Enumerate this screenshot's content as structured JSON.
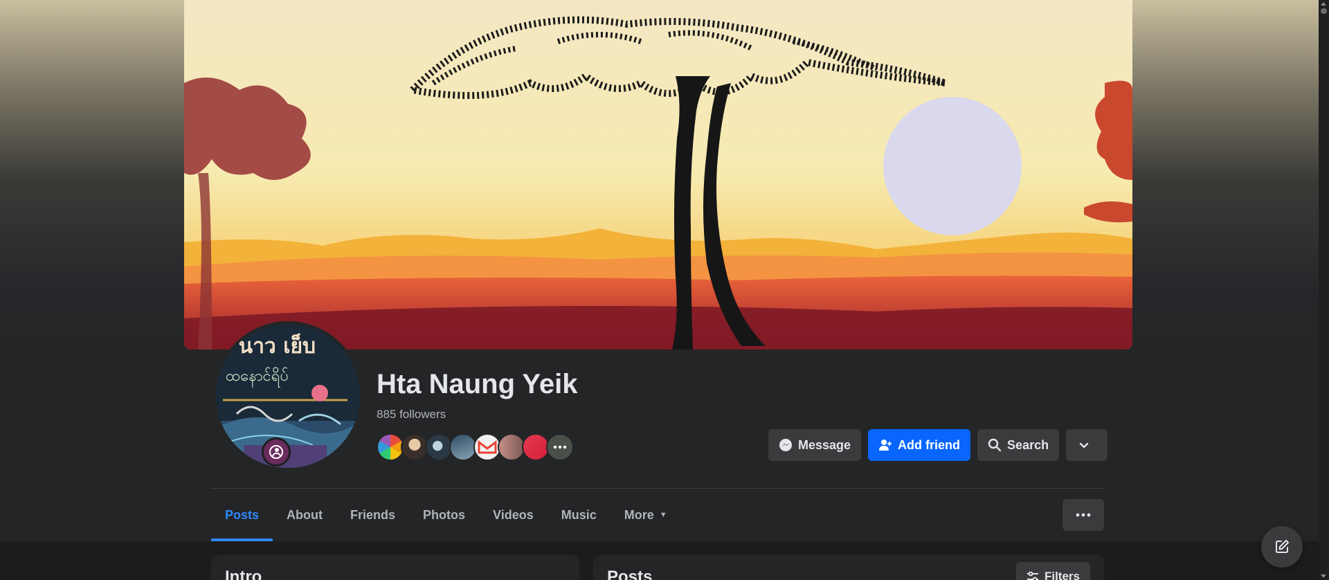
{
  "profile": {
    "name": "Hta Naung Yeik",
    "followers_text": "885 followers"
  },
  "actions": {
    "message_label": "Message",
    "add_friend_label": "Add friend",
    "search_label": "Search"
  },
  "tabs": [
    {
      "label": "Posts",
      "active": true
    },
    {
      "label": "About"
    },
    {
      "label": "Friends"
    },
    {
      "label": "Photos"
    },
    {
      "label": "Videos"
    },
    {
      "label": "Music"
    },
    {
      "label": "More"
    }
  ],
  "cards": {
    "intro_title": "Intro",
    "posts_title": "Posts",
    "filters_label": "Filters"
  },
  "colors": {
    "primary_button": "#0866ff",
    "active_tab": "#2d88ff",
    "surface": "#242526"
  }
}
